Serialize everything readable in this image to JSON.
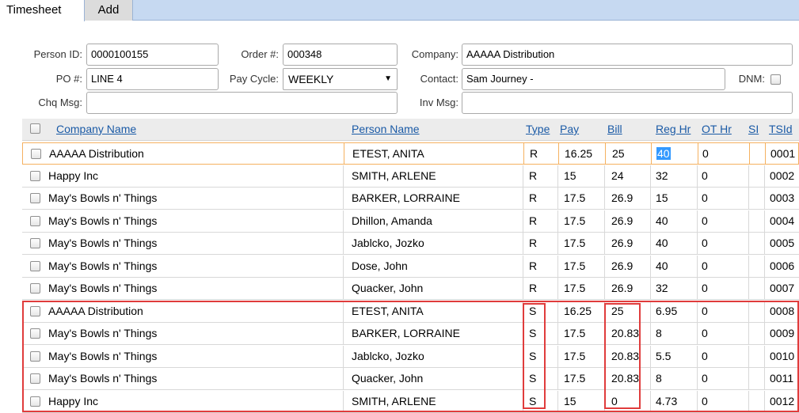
{
  "tabs": [
    {
      "label": "Timesheet",
      "active": true
    },
    {
      "label": "Add",
      "active": false
    }
  ],
  "form": {
    "person_id_label": "Person ID:",
    "person_id_value": "0000100155",
    "order_label": "Order #:",
    "order_value": "000348",
    "company_label": "Company:",
    "company_value": "AAAAA Distribution",
    "po_label": "PO #:",
    "po_value": "LINE 4",
    "pay_cycle_label": "Pay Cycle:",
    "pay_cycle_value": "WEEKLY",
    "contact_label": "Contact:",
    "contact_value": "Sam Journey -",
    "dnm_label": "DNM:",
    "chq_msg_label": "Chq Msg:",
    "chq_msg_value": "",
    "inv_msg_label": "Inv Msg:",
    "inv_msg_value": ""
  },
  "grid": {
    "headers": {
      "company": "Company Name",
      "person": "Person Name",
      "type": "Type",
      "pay": "Pay",
      "bill": "Bill",
      "reg": "Reg Hr",
      "ot": "OT Hr",
      "si": "SI",
      "tsid": "TSId"
    },
    "rows": [
      {
        "company": "AAAAA Distribution",
        "person": "ETEST, ANITA",
        "type": "R",
        "pay": "16.25",
        "bill": "25",
        "reg": "40",
        "ot": "0",
        "tsid": "0001"
      },
      {
        "company": "Happy Inc",
        "person": "SMITH, ARLENE",
        "type": "R",
        "pay": "15",
        "bill": "24",
        "reg": "32",
        "ot": "0",
        "tsid": "0002"
      },
      {
        "company": "May's Bowls n' Things",
        "person": "BARKER, LORRAINE",
        "type": "R",
        "pay": "17.5",
        "bill": "26.9",
        "reg": "15",
        "ot": "0",
        "tsid": "0003"
      },
      {
        "company": "May's Bowls n' Things",
        "person": "Dhillon, Amanda",
        "type": "R",
        "pay": "17.5",
        "bill": "26.9",
        "reg": "40",
        "ot": "0",
        "tsid": "0004"
      },
      {
        "company": "May's Bowls n' Things",
        "person": "Jablcko, Jozko",
        "type": "R",
        "pay": "17.5",
        "bill": "26.9",
        "reg": "40",
        "ot": "0",
        "tsid": "0005"
      },
      {
        "company": "May's Bowls n' Things",
        "person": "Dose, John",
        "type": "R",
        "pay": "17.5",
        "bill": "26.9",
        "reg": "40",
        "ot": "0",
        "tsid": "0006"
      },
      {
        "company": "May's Bowls n' Things",
        "person": "Quacker, John",
        "type": "R",
        "pay": "17.5",
        "bill": "26.9",
        "reg": "32",
        "ot": "0",
        "tsid": "0007"
      },
      {
        "company": "AAAAA Distribution",
        "person": "ETEST, ANITA",
        "type": "S",
        "pay": "16.25",
        "bill": "25",
        "reg": "6.95",
        "ot": "0",
        "tsid": "0008"
      },
      {
        "company": "May's Bowls n' Things",
        "person": "BARKER, LORRAINE",
        "type": "S",
        "pay": "17.5",
        "bill": "20.83",
        "reg": "8",
        "ot": "0",
        "tsid": "0009"
      },
      {
        "company": "May's Bowls n' Things",
        "person": "Jablcko, Jozko",
        "type": "S",
        "pay": "17.5",
        "bill": "20.83",
        "reg": "5.5",
        "ot": "0",
        "tsid": "0010"
      },
      {
        "company": "May's Bowls n' Things",
        "person": "Quacker, John",
        "type": "S",
        "pay": "17.5",
        "bill": "20.83",
        "reg": "8",
        "ot": "0",
        "tsid": "0011"
      },
      {
        "company": "Happy Inc",
        "person": "SMITH, ARLENE",
        "type": "S",
        "pay": "15",
        "bill": "0",
        "reg": "4.73",
        "ot": "0",
        "tsid": "0012"
      }
    ]
  },
  "colors": {
    "tab_bar": "#c6d9f1",
    "header_link": "#1a5aa6",
    "selected_row_border": "#f5b160",
    "selection_highlight": "#3399ff",
    "annotation_red": "#e03c3c"
  }
}
